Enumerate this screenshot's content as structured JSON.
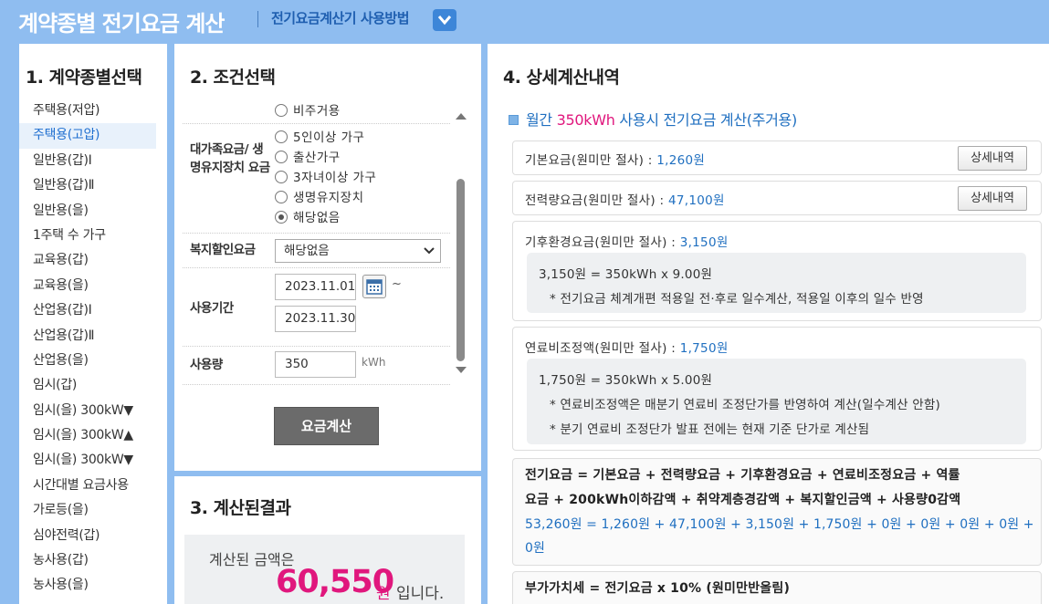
{
  "header": {
    "title": "계약종별 전기요금 계산",
    "howto_link": "전기요금계산기 사용방법"
  },
  "panel1": {
    "title": "1. 계약종별선택",
    "items": [
      "주택용(저압)",
      "주택용(고압)",
      "일반용(갑)Ⅰ",
      "일반용(갑)Ⅱ",
      "일반용(을)",
      "1주택 수 가구",
      "교육용(갑)",
      "교육용(을)",
      "산업용(갑)Ⅰ",
      "산업용(갑)Ⅱ",
      "산업용(을)",
      "임시(갑)",
      "임시(을) 300kW▼",
      "임시(을) 300kW▲",
      "임시(을) 300kW▼",
      "시간대별 요금사용",
      "가로등(을)",
      "심야전력(갑)",
      "농사용(갑)",
      "농사용(을)"
    ],
    "active_index": 1
  },
  "panel2": {
    "title": "2. 조건선택",
    "partial_option": "비주거용",
    "family_label": "대가족요금/ 생명유지장치 요금",
    "family_options": [
      "5인이상 가구",
      "출산가구",
      "3자녀이상 가구",
      "생명유지장치",
      "해당없음"
    ],
    "family_selected": 4,
    "welfare_label": "복지할인요금",
    "welfare_value": "해당없음",
    "period_label": "사용기간",
    "period_start": "2023.11.01",
    "period_end": "2023.11.30",
    "tilde": "~",
    "usage_label": "사용량",
    "usage_value": "350",
    "usage_unit": "kWh",
    "calc_button": "요금계산"
  },
  "panel3": {
    "title": "3. 계산된결과",
    "result_prefix": "계산된 금액은",
    "amount": "60,550",
    "won": "원",
    "suffix": "입니다."
  },
  "panel4": {
    "title": "4. 상세계산내역",
    "subtitle_pre": "월간 ",
    "subtitle_hl": "350kWh",
    "subtitle_post": " 사용시 전기요금 계산(주거용)",
    "basic": {
      "label": "기본요금(원미만 절사) : ",
      "value": "1,260원",
      "button": "상세내역"
    },
    "energy": {
      "label": "전력량요금(원미만 절사) : ",
      "value": "47,100원",
      "button": "상세내역"
    },
    "climate": {
      "label": "기후환경요금(원미만 절사) : ",
      "value": "3,150원",
      "line1": "3,150원 = 350kWh x 9.00원",
      "line2": "* 전기요금 체계개편 적용일 전·후로 일수계산, 적용일 이후의 일수 반영"
    },
    "fuel": {
      "label": "연료비조정액(원미만 절사) : ",
      "value": "1,750원",
      "line1": "1,750원 = 350kWh x 5.00원",
      "line2": "* 연료비조정액은 매분기 연료비 조정단가를 반영하여 계산(일수계산 안함)",
      "line3": "* 분기 연료비 조정단가 발표 전에는 현재 기준 단가로 계산됨"
    },
    "total": {
      "formula_line1": "전기요금 = 기본요금 + 전력량요금 + 기후환경요금 + 연료비조정요금 + 역률",
      "formula_line2": "요금 + 200kWh이하감액 + 취약계층경감액 + 복지할인금액 + 사용량0감액",
      "values_line1": "53,260원 = 1,260원 + 47,100원 + 3,150원 + 1,750원 + 0원 + 0원 + 0원 + 0원 +",
      "values_line2": "0원"
    },
    "vat": {
      "formula": "부가가치세 = 전기요금 x 10% (원미만반올림)"
    }
  }
}
